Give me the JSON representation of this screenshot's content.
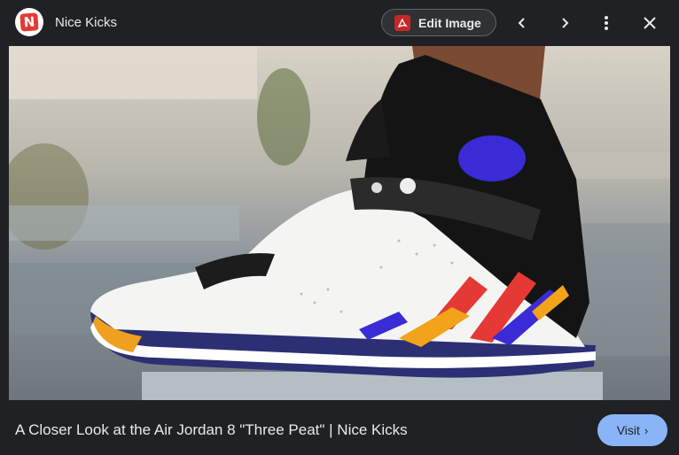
{
  "header": {
    "site_name": "Nice Kicks",
    "logo_letter": "N",
    "edit_label": "Edit Image"
  },
  "icons": {
    "site_logo": "nice-kicks-logo",
    "edit": "pdf-icon",
    "previous": "chevron-left-icon",
    "next": "chevron-right-icon",
    "more": "more-vert-icon",
    "close": "close-icon",
    "lens": "lens-icon"
  },
  "image": {
    "subject": "Air Jordan 8 Three Peat sneaker on foot"
  },
  "footer": {
    "caption": "A Closer Look at the Air Jordan 8 \"Three Peat\" | Nice Kicks",
    "visit_label": "Visit",
    "visit_chevron": "›"
  },
  "colors": {
    "background": "#202124",
    "accent_button": "#8ab4f8",
    "text": "#e8eaed"
  }
}
